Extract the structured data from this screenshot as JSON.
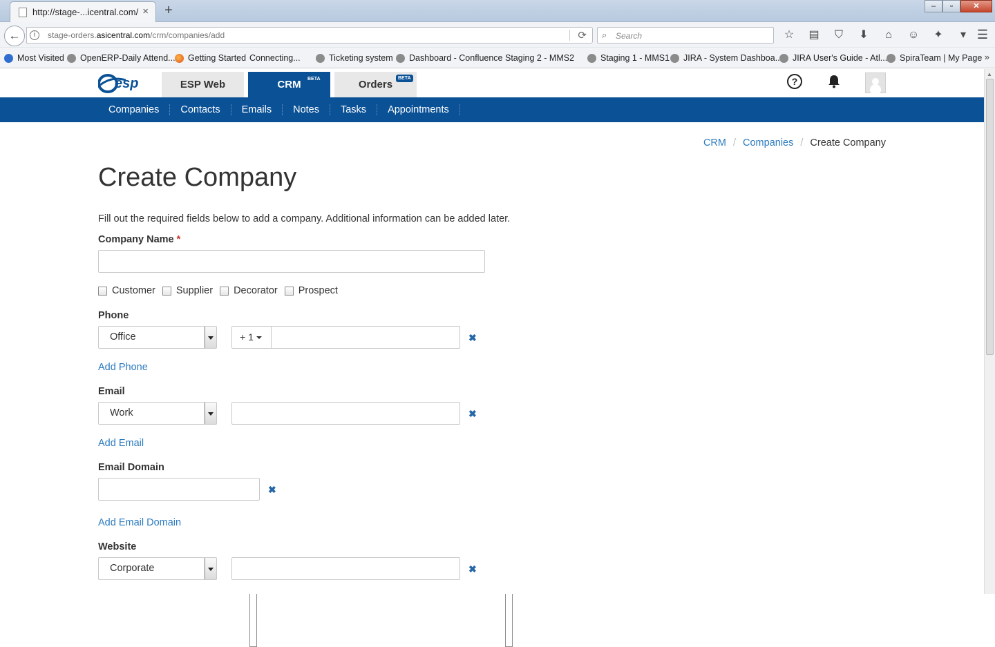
{
  "browser": {
    "tab_title": "http://stage-...icentral.com/",
    "tab_close": "×",
    "new_tab": "+",
    "window_controls": [
      "–",
      "▫",
      "✕"
    ],
    "url_prefix": "stage-orders.",
    "url_domain": "asicentral.com",
    "url_path": "/crm/companies/add",
    "search_placeholder": "Search",
    "toolbar_icons": [
      "star-icon",
      "reading-list-icon",
      "pocket-icon",
      "download-icon",
      "home-icon",
      "chat-icon",
      "extension-icon"
    ],
    "bookmarks": [
      {
        "label": "Most Visited",
        "icon": "page"
      },
      {
        "label": "OpenERP-Daily Attend...",
        "icon": "globe"
      },
      {
        "label": "Getting Started",
        "icon": "firefox"
      },
      {
        "label": "Connecting...",
        "icon": "page"
      },
      {
        "label": "Ticketing system",
        "icon": "globe"
      },
      {
        "label": "Dashboard - Confluence",
        "icon": "globe"
      },
      {
        "label": "Staging 2 - MMS2",
        "icon": "page"
      },
      {
        "label": "Staging 1 - MMS1",
        "icon": "globe"
      },
      {
        "label": "JIRA - System Dashboa...",
        "icon": "globe"
      },
      {
        "label": "JIRA User's Guide - Atl...",
        "icon": "globe"
      },
      {
        "label": "SpiraTeam | My Page",
        "icon": "globe"
      }
    ],
    "bookmarks_more": "»"
  },
  "header": {
    "logo_text": "esp",
    "tabs": [
      {
        "label": "ESP Web",
        "beta": false
      },
      {
        "label": "CRM",
        "beta": true
      },
      {
        "label": "Orders",
        "beta": true
      }
    ],
    "beta_label": "BETA",
    "help_symbol": "?"
  },
  "subnav": [
    "Companies",
    "Contacts",
    "Emails",
    "Notes",
    "Tasks",
    "Appointments"
  ],
  "breadcrumb": {
    "items": [
      "CRM",
      "Companies"
    ],
    "current": "Create Company",
    "separator": "/"
  },
  "form": {
    "title": "Create Company",
    "intro": "Fill out the required fields below to add a company. Additional information can be added later.",
    "company_name_label": "Company Name",
    "required_marker": "*",
    "company_name_value": "",
    "checkboxes": [
      "Customer",
      "Supplier",
      "Decorator",
      "Prospect"
    ],
    "phone": {
      "label": "Phone",
      "type": "Office",
      "country_code": "+ 1",
      "number": "",
      "add_label": "Add Phone"
    },
    "email": {
      "label": "Email",
      "type": "Work",
      "value": "",
      "add_label": "Add Email"
    },
    "email_domain": {
      "label": "Email Domain",
      "value": "",
      "add_label": "Add Email Domain"
    },
    "website": {
      "label": "Website",
      "type": "Corporate",
      "value": ""
    },
    "remove_symbol": "✖"
  },
  "colors": {
    "brand_blue": "#0a5196",
    "link_blue": "#2a7abf",
    "required_red": "#c0392b"
  }
}
